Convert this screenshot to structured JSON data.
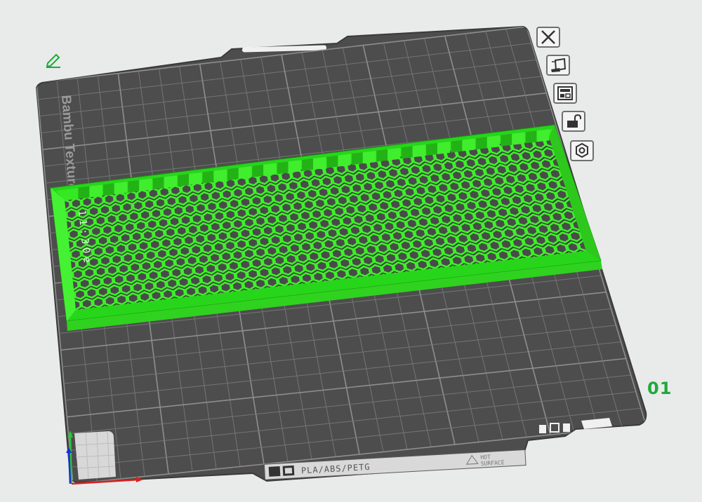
{
  "plate": {
    "brand_text": "Bambu Textured",
    "material_label": "PLA/ABS/PETG",
    "hot_surface_line1": "HOT",
    "hot_surface_line2": "SURFACE",
    "plate_number": "01"
  },
  "model": {
    "name": "hex grid drawer bin",
    "color": "#3ef02a",
    "embossed_text": "11:30e"
  },
  "toolbar": {
    "buttons": [
      {
        "name": "close-plate-button",
        "icon": "close-icon"
      },
      {
        "name": "auto-orient-button",
        "icon": "auto-orient-icon"
      },
      {
        "name": "arrange-button",
        "icon": "arrange-icon"
      },
      {
        "name": "lock-plate-button",
        "icon": "unlock-icon"
      },
      {
        "name": "plate-settings-button",
        "icon": "gear-icon"
      }
    ]
  },
  "colors": {
    "background": "#e9eaea",
    "plate": "#4d4d4d",
    "grid": "#7c7c7c",
    "accent_green": "#1faa3a",
    "model_green": "#3ef02a"
  }
}
